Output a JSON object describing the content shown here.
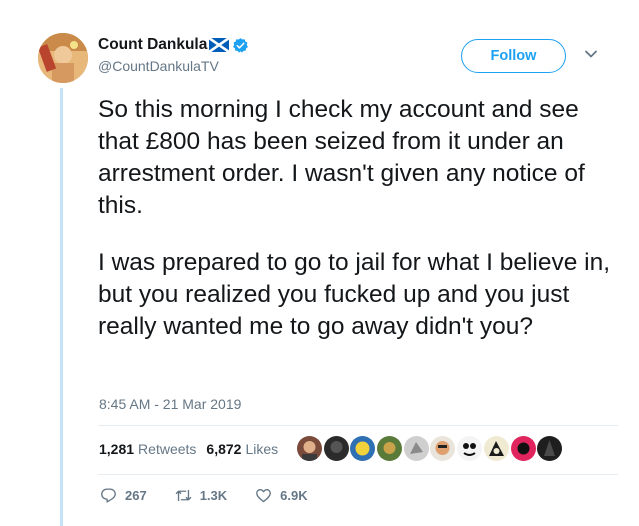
{
  "author": {
    "display_name": "Count Dankula",
    "handle": "@CountDankulaTV",
    "verified": true
  },
  "follow_label": "Follow",
  "tweet": {
    "paragraphs": [
      "So this morning I check my account and see that £800 has been seized from it under an arrestment order. I wasn't given any notice of this.",
      "I was prepared to go to jail for what I believe in, but you realized you fucked up and you just really wanted me to go away didn't you?"
    ],
    "timestamp": "8:45 AM - 21 Mar 2019"
  },
  "stats": {
    "retweets_count": "1,281",
    "retweets_label": "Retweets",
    "likes_count": "6,872",
    "likes_label": "Likes"
  },
  "actions": {
    "reply_count": "267",
    "retweet_count": "1.3K",
    "like_count": "6.9K"
  },
  "colors": {
    "accent": "#1da1f2",
    "text": "#14171a",
    "muted": "#657786",
    "thread": "#c4e3f7"
  },
  "icons": [
    "scotland-flag-icon",
    "verified-badge-icon",
    "chevron-down-icon",
    "reply-icon",
    "retweet-icon",
    "like-icon"
  ]
}
